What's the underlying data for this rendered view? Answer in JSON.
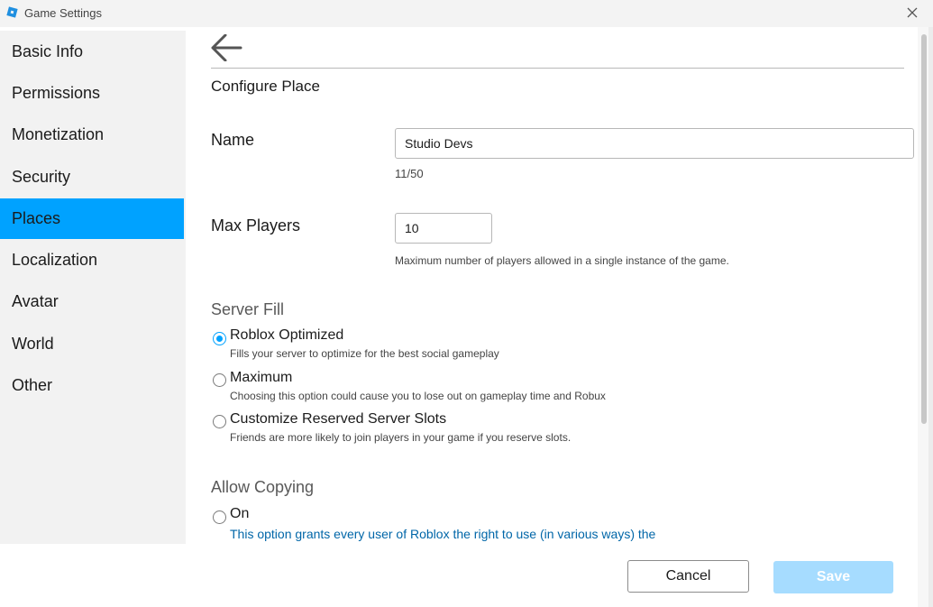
{
  "window": {
    "title": "Game Settings"
  },
  "sidebar": {
    "items": [
      {
        "label": "Basic Info",
        "active": false
      },
      {
        "label": "Permissions",
        "active": false
      },
      {
        "label": "Monetization",
        "active": false
      },
      {
        "label": "Security",
        "active": false
      },
      {
        "label": "Places",
        "active": true
      },
      {
        "label": "Localization",
        "active": false
      },
      {
        "label": "Avatar",
        "active": false
      },
      {
        "label": "World",
        "active": false
      },
      {
        "label": "Other",
        "active": false
      }
    ]
  },
  "main": {
    "heading": "Configure Place",
    "name": {
      "label": "Name",
      "value": "Studio Devs",
      "count": "11/50"
    },
    "max_players": {
      "label": "Max Players",
      "value": "10",
      "help": "Maximum number of players allowed in a single instance of the game."
    },
    "server_fill": {
      "heading": "Server Fill",
      "options": [
        {
          "label": "Roblox Optimized",
          "desc": "Fills your server to optimize for the best social gameplay",
          "selected": true
        },
        {
          "label": "Maximum",
          "desc": "Choosing this option could cause you to lose out on gameplay time and Robux",
          "selected": false
        },
        {
          "label": "Customize Reserved Server Slots",
          "desc": "Friends are more likely to join players in your game if you reserve slots.",
          "selected": false
        }
      ]
    },
    "allow_copying": {
      "heading": "Allow Copying",
      "options": [
        {
          "label": "On",
          "desc": "This option grants every user of Roblox the right to use (in various ways) the",
          "selected": false
        }
      ]
    }
  },
  "footer": {
    "cancel_label": "Cancel",
    "save_label": "Save"
  },
  "colors": {
    "accent": "#00a2ff",
    "save_disabled": "#a6dcff",
    "link": "#0066a8"
  }
}
